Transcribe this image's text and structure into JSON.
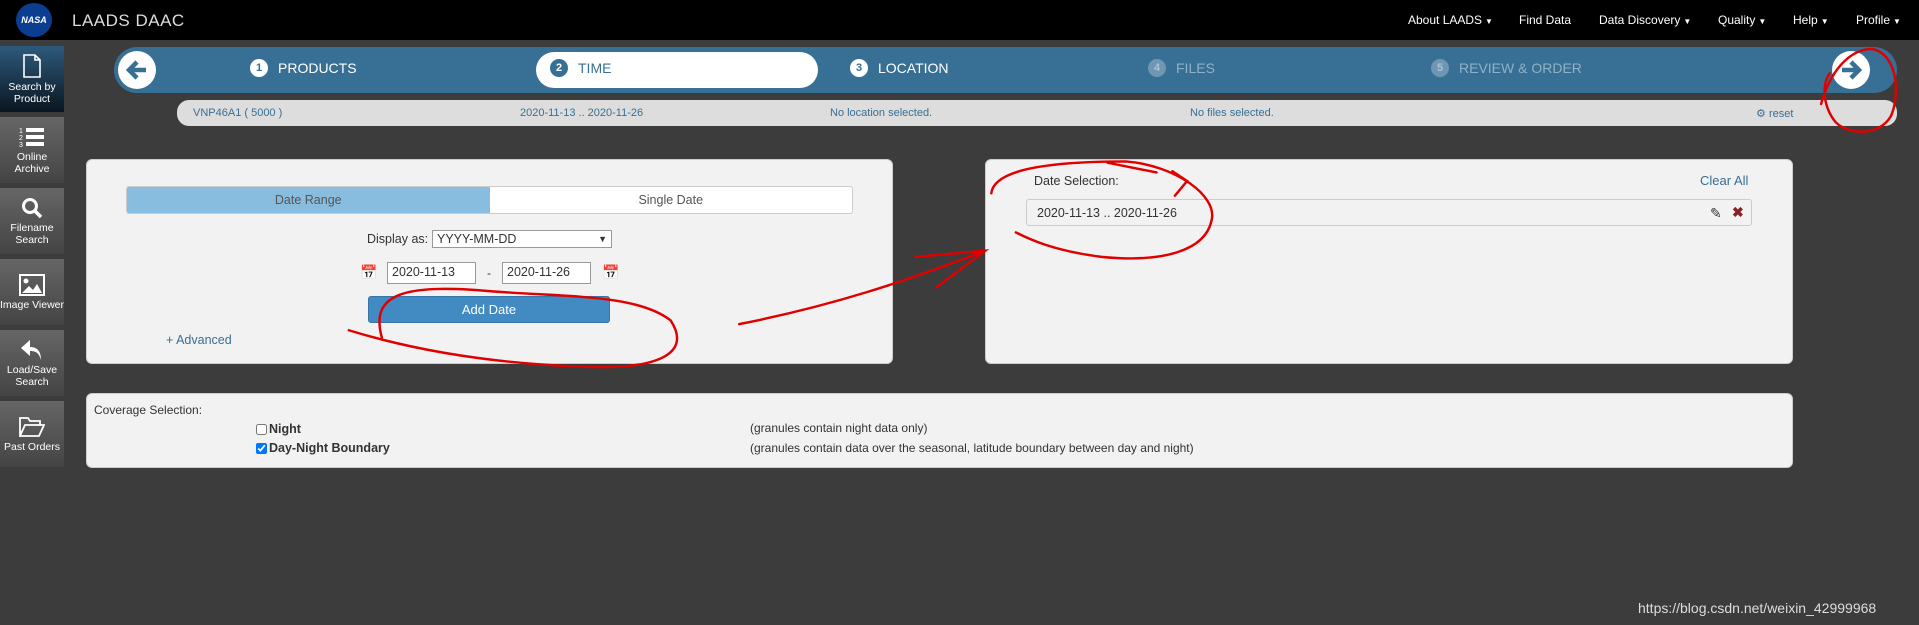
{
  "header": {
    "logo_text": "NASA",
    "title": "LAADS DAAC",
    "nav": [
      {
        "label": "About LAADS",
        "caret": true
      },
      {
        "label": "Find Data",
        "caret": false
      },
      {
        "label": "Data Discovery",
        "caret": true
      },
      {
        "label": "Quality",
        "caret": true
      },
      {
        "label": "Help",
        "caret": true
      },
      {
        "label": "Profile",
        "caret": true
      }
    ]
  },
  "sidebar": {
    "items": [
      {
        "label": "Search by Product",
        "icon": "file-icon",
        "active": true
      },
      {
        "label": "Online Archive",
        "icon": "ordered-list-icon"
      },
      {
        "label": "Filename Search",
        "icon": "search-icon"
      },
      {
        "label": "Image Viewer",
        "icon": "image-icon"
      },
      {
        "label": "Load/Save Search",
        "icon": "reply-icon"
      },
      {
        "label": "Past Orders",
        "icon": "folder-open-icon"
      }
    ]
  },
  "steps": [
    {
      "num": "1",
      "label": "PRODUCTS"
    },
    {
      "num": "2",
      "label": "TIME",
      "active": true
    },
    {
      "num": "3",
      "label": "LOCATION"
    },
    {
      "num": "4",
      "label": "FILES",
      "disabled": true
    },
    {
      "num": "5",
      "label": "REVIEW & ORDER",
      "disabled": true
    }
  ],
  "summary": {
    "product": "VNP46A1 ( 5000 )",
    "time": "2020-11-13 .. 2020-11-26",
    "location": "No location selected.",
    "files": "No files selected.",
    "reset": "reset"
  },
  "date_panel": {
    "tab_range": "Date Range",
    "tab_single": "Single Date",
    "display_as_label": "Display as:",
    "display_as_value": "YYYY-MM-DD",
    "start_date": "2020-11-13",
    "separator": "-",
    "end_date": "2020-11-26",
    "add_button": "Add Date",
    "advanced": "+ Advanced"
  },
  "selection_panel": {
    "label": "Date Selection:",
    "clear_all": "Clear All",
    "items": [
      "2020-11-13 .. 2020-11-26"
    ]
  },
  "coverage": {
    "label": "Coverage Selection:",
    "options": [
      {
        "label": "Night",
        "checked": false,
        "description": "(granules contain night data only)"
      },
      {
        "label": "Day-Night Boundary",
        "checked": true,
        "description": "(granules contain data over the seasonal, latitude boundary between day and night)"
      }
    ]
  },
  "watermark": "https://blog.csdn.net/weixin_42999968",
  "colors": {
    "accent": "#386f94",
    "button": "#428bc2",
    "annotation": "#e00000"
  }
}
